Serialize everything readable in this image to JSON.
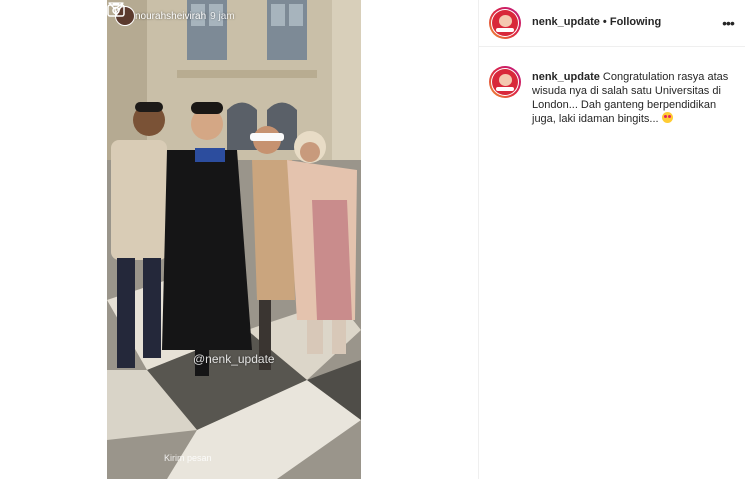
{
  "story": {
    "username": "nourahsheivirah",
    "time": "9 jam",
    "watermark": "@nenk_update",
    "reply_placeholder": "Kirim pesan",
    "camera_icon": "camera-icon",
    "send_icon": "send-icon"
  },
  "header": {
    "username": "nenk_update",
    "separator": "•",
    "follow_status": "Following",
    "more_icon": "more-options-icon"
  },
  "caption": {
    "username": "nenk_update",
    "text": "Congratulation rasya atas wisuda nya di salah satu Universitas di London... Dah ganteng berpendidikan juga, laki idaman bingits...",
    "emoji": "heart-eyes-emoji"
  }
}
